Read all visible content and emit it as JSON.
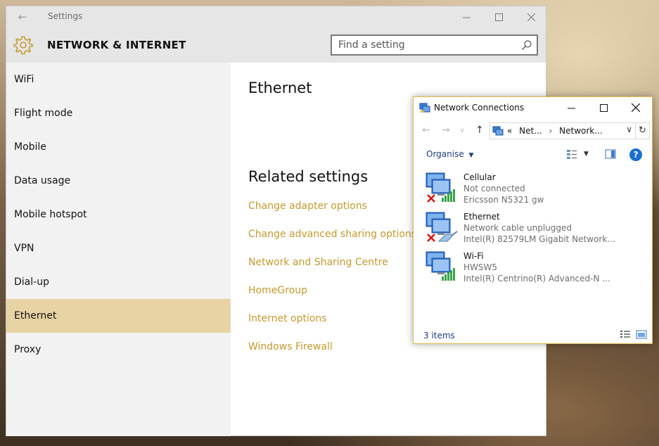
{
  "settings": {
    "title": "Settings",
    "header_title": "NETWORK & INTERNET",
    "search": {
      "placeholder": "Find a setting"
    },
    "nav": [
      {
        "label": "WiFi"
      },
      {
        "label": "Flight mode"
      },
      {
        "label": "Mobile"
      },
      {
        "label": "Data usage"
      },
      {
        "label": "Mobile hotspot"
      },
      {
        "label": "VPN"
      },
      {
        "label": "Dial-up"
      },
      {
        "label": "Ethernet",
        "active": true
      },
      {
        "label": "Proxy"
      }
    ],
    "page_title": "Ethernet",
    "related_heading": "Related settings",
    "links": [
      "Change adapter options",
      "Change advanced sharing options",
      "Network and Sharing Centre",
      "HomeGroup",
      "Internet options",
      "Windows Firewall"
    ],
    "accent_color": "#c39a2e",
    "selected_color": "#e8d3a5"
  },
  "network_connections": {
    "title": "Network Connections",
    "address": {
      "prefix": "«",
      "crumb1": "Net...",
      "crumb2": "Network..."
    },
    "organise_label": "Organise",
    "items": [
      {
        "name": "Cellular",
        "status": "Not connected",
        "device": "Ericsson N5321 gw",
        "icon": "cellular-adapter-icon",
        "disconnected": true
      },
      {
        "name": "Ethernet",
        "status": "Network cable unplugged",
        "device": "Intel(R) 82579LM Gigabit Network...",
        "icon": "ethernet-adapter-icon",
        "disconnected": true
      },
      {
        "name": "Wi-Fi",
        "status": "HWSW5",
        "device": "Intel(R) Centrino(R) Advanced-N ...",
        "icon": "wifi-adapter-icon",
        "disconnected": false
      }
    ],
    "item_count": "3 items"
  }
}
